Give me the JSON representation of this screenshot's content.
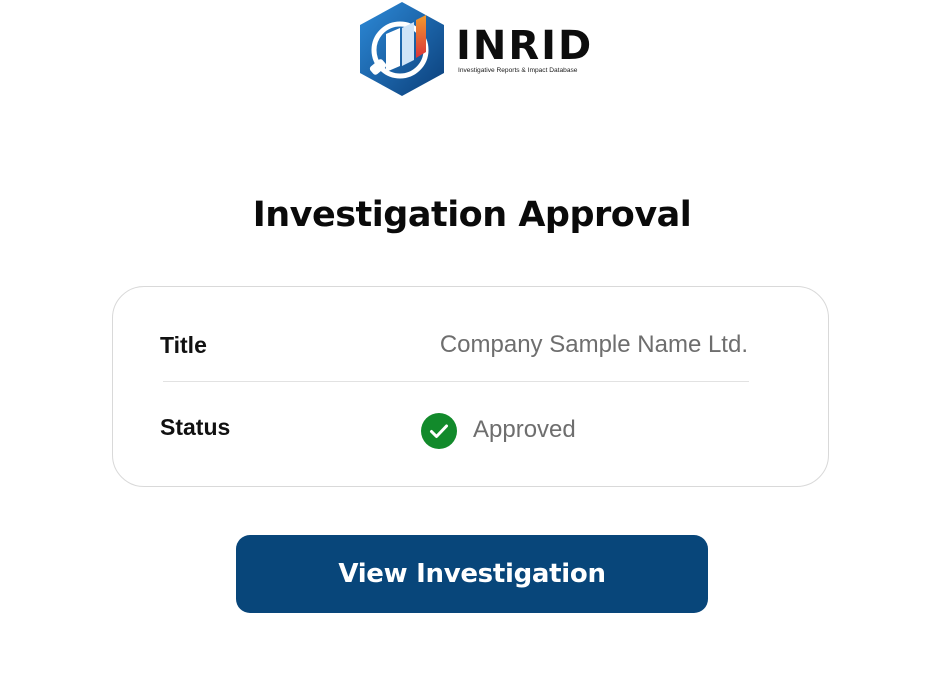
{
  "brand": {
    "name": "INRID",
    "tagline": "Investigative Reports & Impact Database",
    "logo_icon": "inrid-logo-icon",
    "colors": {
      "hex_blue": "#1f74c1",
      "hex_dark": "#0b3f7a",
      "accent_red": "#e0403a",
      "accent_orange": "#f29a2e"
    }
  },
  "page": {
    "title": "Investigation Approval"
  },
  "details": {
    "title_label": "Title",
    "title_value": "Company Sample Name Ltd.",
    "status_label": "Status",
    "status_value": "Approved",
    "status_icon": "check-circle-icon",
    "status_color": "#128a2b"
  },
  "actions": {
    "view_label": "View Investigation",
    "button_color": "#08467a"
  }
}
